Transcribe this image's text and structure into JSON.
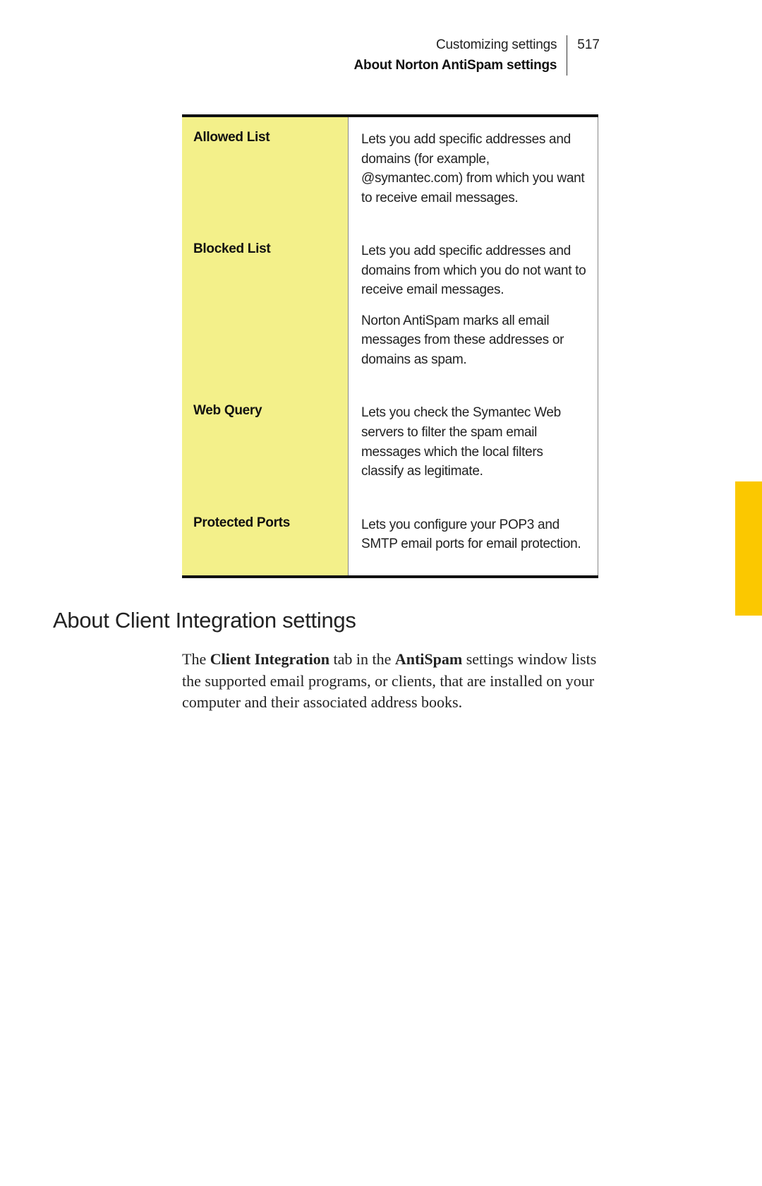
{
  "header": {
    "chapter": "Customizing settings",
    "section": "About Norton AntiSpam settings",
    "page_number": "517"
  },
  "table": {
    "rows": [
      {
        "label": "Allowed List",
        "paragraphs": [
          "Lets you add specific addresses and domains (for example, @symantec.com) from which you want to receive email messages."
        ]
      },
      {
        "label": "Blocked List",
        "paragraphs": [
          "Lets you add specific addresses and domains from which you do not want to receive email messages.",
          "Norton AntiSpam marks all email messages from these addresses or domains as spam."
        ]
      },
      {
        "label": "Web Query",
        "paragraphs": [
          "Lets you check the Symantec Web servers to filter the spam email messages which the local filters classify as legitimate."
        ]
      },
      {
        "label": "Protected Ports",
        "paragraphs": [
          "Lets you configure your POP3 and SMTP email ports for email protection."
        ]
      }
    ]
  },
  "section_heading": "About Client Integration settings",
  "body": {
    "pre": "The ",
    "bold1": "Client Integration",
    "mid1": " tab in the ",
    "bold2": "AntiSpam",
    "rest": " settings window lists the supported email programs, or clients, that are installed on your computer and their associated address books."
  }
}
